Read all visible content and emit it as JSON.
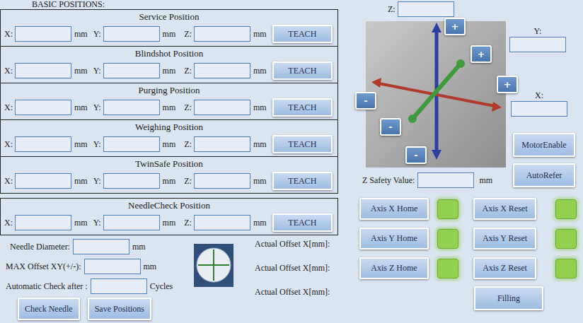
{
  "heading": "BASIC POSITIONS:",
  "positions": [
    {
      "title": "Service Position",
      "fields": [
        {
          "label": "X:",
          "value": "",
          "unit": "mm"
        },
        {
          "label": "Y:",
          "value": "",
          "unit": "mm"
        },
        {
          "label": "Z:",
          "value": "",
          "unit": "mm"
        }
      ],
      "button": "TEACH"
    },
    {
      "title": "Blindshot Position",
      "fields": [
        {
          "label": "X:",
          "value": "",
          "unit": "mm"
        },
        {
          "label": "Y:",
          "value": "",
          "unit": "mm"
        },
        {
          "label": "Z:",
          "value": "",
          "unit": "mm"
        }
      ],
      "button": "TEACH"
    },
    {
      "title": "Purging Position",
      "fields": [
        {
          "label": "X:",
          "value": "",
          "unit": "mm"
        },
        {
          "label": "Y:",
          "value": "",
          "unit": "mm"
        },
        {
          "label": "Z:",
          "value": "",
          "unit": "mm"
        }
      ],
      "button": "TEACH"
    },
    {
      "title": "Weighing Position",
      "fields": [
        {
          "label": "X:",
          "value": "",
          "unit": "mm"
        },
        {
          "label": "Y:",
          "value": "",
          "unit": "mm"
        },
        {
          "label": "Z:",
          "value": "",
          "unit": "mm"
        }
      ],
      "button": "TEACH"
    },
    {
      "title": "TwinSafe Position",
      "fields": [
        {
          "label": "X:",
          "value": "",
          "unit": "mm"
        },
        {
          "label": "Y:",
          "value": "",
          "unit": "mm"
        },
        {
          "label": "Z:",
          "value": "",
          "unit": "mm"
        }
      ],
      "button": "TEACH"
    },
    {
      "title": "NeedleCheck Position",
      "fields": [
        {
          "label": "X:",
          "value": "",
          "unit": "mm"
        },
        {
          "label": "Y:",
          "value": "",
          "unit": "mm"
        },
        {
          "label": "Z:",
          "value": "",
          "unit": "mm"
        }
      ],
      "button": "TEACH"
    }
  ],
  "needle": {
    "fields": [
      {
        "label": "Needle Diameter:",
        "value": "",
        "unit": "mm"
      },
      {
        "label": "MAX Offset XY(+/-):",
        "value": "",
        "unit": "mm"
      },
      {
        "label": "Automatic Check after :",
        "value": "",
        "unit": "Cycles"
      }
    ],
    "buttons": [
      "Check Needle",
      "Save Positions"
    ],
    "offsets": [
      "Actual Offset X[mm]:",
      "Actual Offset X[mm]:",
      "Actual Offset X[mm]:"
    ]
  },
  "jog": {
    "z_label": "Z:",
    "z_value": "",
    "y_label": "Y:",
    "y_value": "",
    "x_label": "X:",
    "x_value": "",
    "buttons": [
      {
        "label": "+"
      },
      {
        "label": "+"
      },
      {
        "label": "+"
      },
      {
        "label": "-"
      },
      {
        "label": "-"
      },
      {
        "label": "-"
      }
    ]
  },
  "motor_enable": "MotorEnable",
  "auto_refer": "AutoRefer",
  "z_safety": {
    "label": "Z Safety Value:",
    "value": "",
    "unit": "mm"
  },
  "axes": [
    {
      "home": "Axis X Home",
      "home_ok": true,
      "reset": "Axis X Reset",
      "reset_ok": true
    },
    {
      "home": "Axis Y Home",
      "home_ok": true,
      "reset": "Axis Y Reset",
      "reset_ok": true
    },
    {
      "home": "Axis Z Home",
      "home_ok": true,
      "reset": "Axis Z Reset",
      "reset_ok": true
    }
  ],
  "filling": "Filling"
}
